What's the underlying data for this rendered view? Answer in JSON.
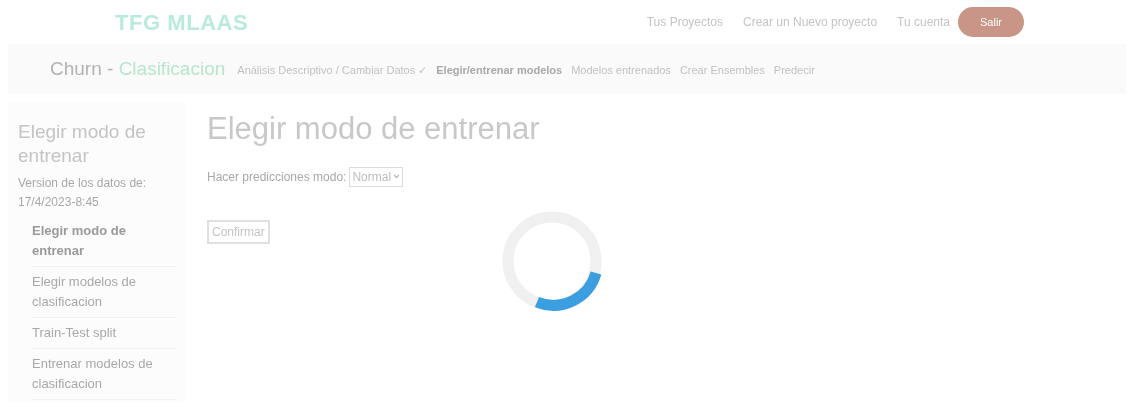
{
  "header": {
    "logo": "TFG MLAAS",
    "links": [
      "Tus Proyectos",
      "Crear un Nuevo proyecto",
      "Tu cuenta"
    ],
    "logout": "Salir"
  },
  "project_bar": {
    "name": "Churn - ",
    "type": "Clasificacion",
    "steps": [
      {
        "label": "Análisis Descriptivo / Cambiar Datos ✓",
        "selected": false
      },
      {
        "label": "Elegir/entrenar modelos",
        "selected": true
      },
      {
        "label": "Modelos entrenados",
        "selected": false
      },
      {
        "label": "Crear Ensembles",
        "selected": false
      },
      {
        "label": "Predecir",
        "selected": false
      }
    ]
  },
  "sidebar": {
    "title": "Elegir modo de entrenar",
    "version": "Version de los datos de: 17/4/2023-8:45",
    "items": [
      {
        "label": "Elegir modo de entrenar",
        "selected": true
      },
      {
        "label": "Elegir modelos de clasificacion",
        "selected": false
      },
      {
        "label": "Train-Test split",
        "selected": false
      },
      {
        "label": "Entrenar modelos de clasificacion",
        "selected": false
      }
    ]
  },
  "main": {
    "title": "Elegir modo de entrenar",
    "mode_label": "Hacer predicciones modo:",
    "mode_value": "Normal",
    "confirm": "Confirmar"
  }
}
